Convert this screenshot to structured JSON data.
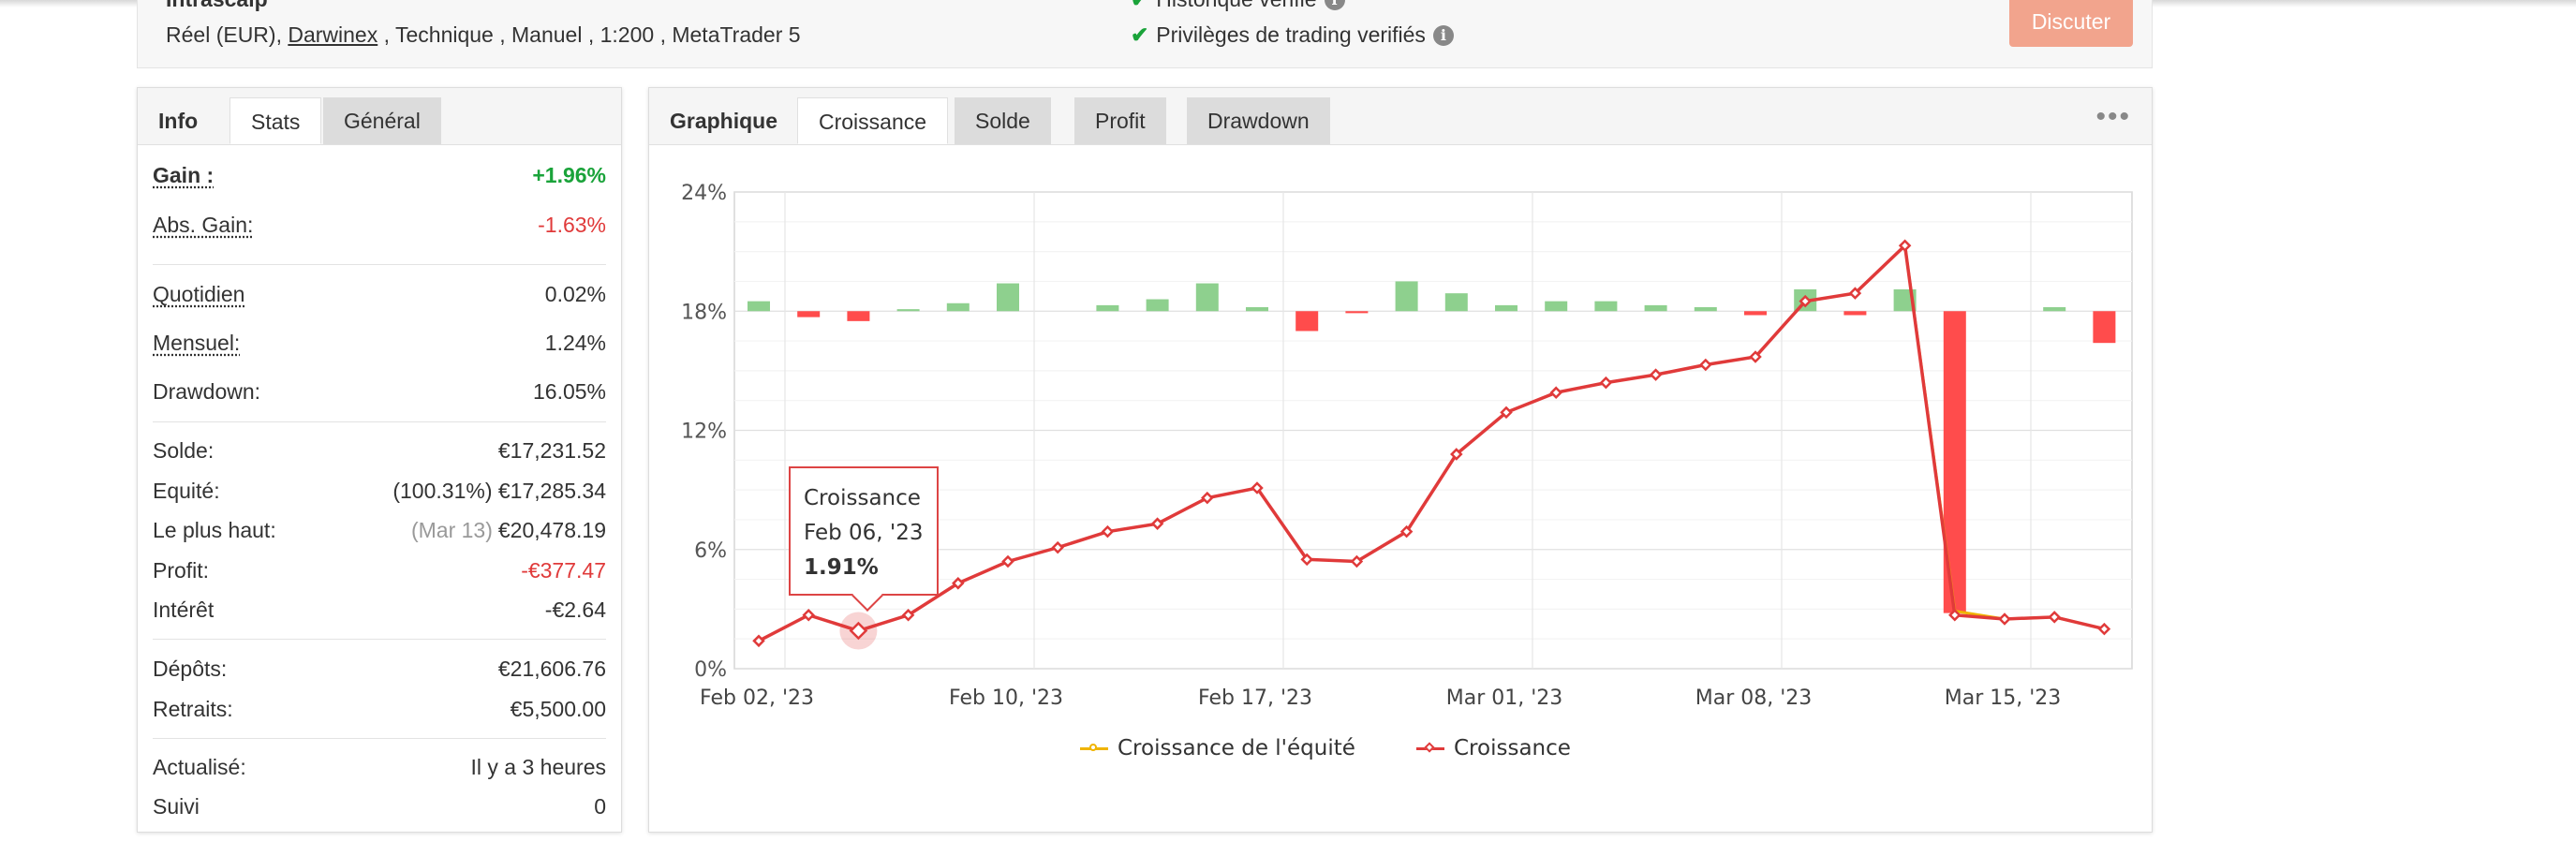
{
  "header": {
    "account_name": "Intrascalp",
    "meta": {
      "part1": "Réel (EUR), ",
      "broker": "Darwinex",
      "part2": " , Technique , Manuel , 1:200 , MetaTrader 5"
    },
    "verified_history": "Historique vérifié",
    "verified_privileges": "Privilèges de trading verifiés",
    "discuss_button": "Discuter"
  },
  "left_tabs": [
    "Info",
    "Stats",
    "Général"
  ],
  "stats": {
    "gain": {
      "label": "Gain :",
      "value": "+1.96%"
    },
    "abs_gain": {
      "label": "Abs. Gain:",
      "value": "-1.63%"
    },
    "daily": {
      "label": "Quotidien",
      "value": "0.02%"
    },
    "monthly": {
      "label": "Mensuel:",
      "value": "1.24%"
    },
    "drawdown": {
      "label": "Drawdown:",
      "value": "16.05%"
    },
    "balance": {
      "label": "Solde:",
      "value": "€17,231.52"
    },
    "equity": {
      "label": "Equité:",
      "sub": "(100.31%)",
      "value": "€17,285.34"
    },
    "highest": {
      "label": "Le plus haut:",
      "sub": "(Mar 13)",
      "value": "€20,478.19"
    },
    "profit": {
      "label": "Profit:",
      "value": "-€377.47"
    },
    "interest": {
      "label": "Intérêt",
      "value": "-€2.64"
    },
    "deposits": {
      "label": "Dépôts:",
      "value": "€21,606.76"
    },
    "withdrawals": {
      "label": "Retraits:",
      "value": "€5,500.00"
    },
    "updated": {
      "label": "Actualisé:",
      "value": "Il y a 3 heures"
    },
    "following": {
      "label": "Suivi",
      "value": "0"
    }
  },
  "right_tabs": {
    "title": "Graphique",
    "items": [
      "Croissance",
      "Solde",
      "Profit",
      "Drawdown"
    ],
    "more": "•••"
  },
  "tooltip": {
    "series": "Croissance",
    "date": "Feb 06, '23",
    "value": "1.91%"
  },
  "colors": {
    "growth": "#e03a3a",
    "equity_growth": "#f0b400",
    "bar_pos": "#8ed08e",
    "bar_neg": "#ff4c4c",
    "accent": "#1aa33a"
  },
  "chart_data": {
    "type": "line",
    "ylim": [
      0,
      24
    ],
    "yticks": [
      "0%",
      "6%",
      "12%",
      "18%",
      "24%"
    ],
    "xticks": [
      "Feb 02, '23",
      "Feb 10, '23",
      "Feb 17, '23",
      "Mar 01, '23",
      "Mar 08, '23",
      "Mar 15, '23"
    ],
    "series": [
      {
        "name": "Croissance",
        "values": [
          1.4,
          2.7,
          1.91,
          2.7,
          4.3,
          5.4,
          6.1,
          6.9,
          7.3,
          8.6,
          9.1,
          5.5,
          5.4,
          6.9,
          10.8,
          12.9,
          13.9,
          14.4,
          14.8,
          15.3,
          15.7,
          18.5,
          18.9,
          21.3,
          2.7,
          2.5,
          2.6,
          2.0
        ]
      },
      {
        "name": "Croissance de l'équité",
        "values": [
          null,
          null,
          null,
          null,
          null,
          null,
          null,
          null,
          null,
          null,
          null,
          null,
          null,
          null,
          null,
          null,
          null,
          null,
          null,
          null,
          null,
          null,
          null,
          21.3,
          2.9,
          2.5,
          2.6,
          2.0
        ]
      }
    ],
    "daily_bars": [
      0.5,
      -0.3,
      -0.5,
      0.1,
      0.4,
      1.4,
      0,
      0.3,
      0.6,
      1.4,
      0.2,
      -1.0,
      -0.1,
      1.5,
      0.9,
      0.3,
      0.5,
      0.5,
      0.3,
      0.2,
      -0.2,
      1.1,
      -0.2,
      1.1,
      -15.2,
      0,
      0.2,
      -1.6
    ]
  },
  "legend": {
    "equity": "Croissance de l'équité",
    "growth": "Croissance"
  }
}
